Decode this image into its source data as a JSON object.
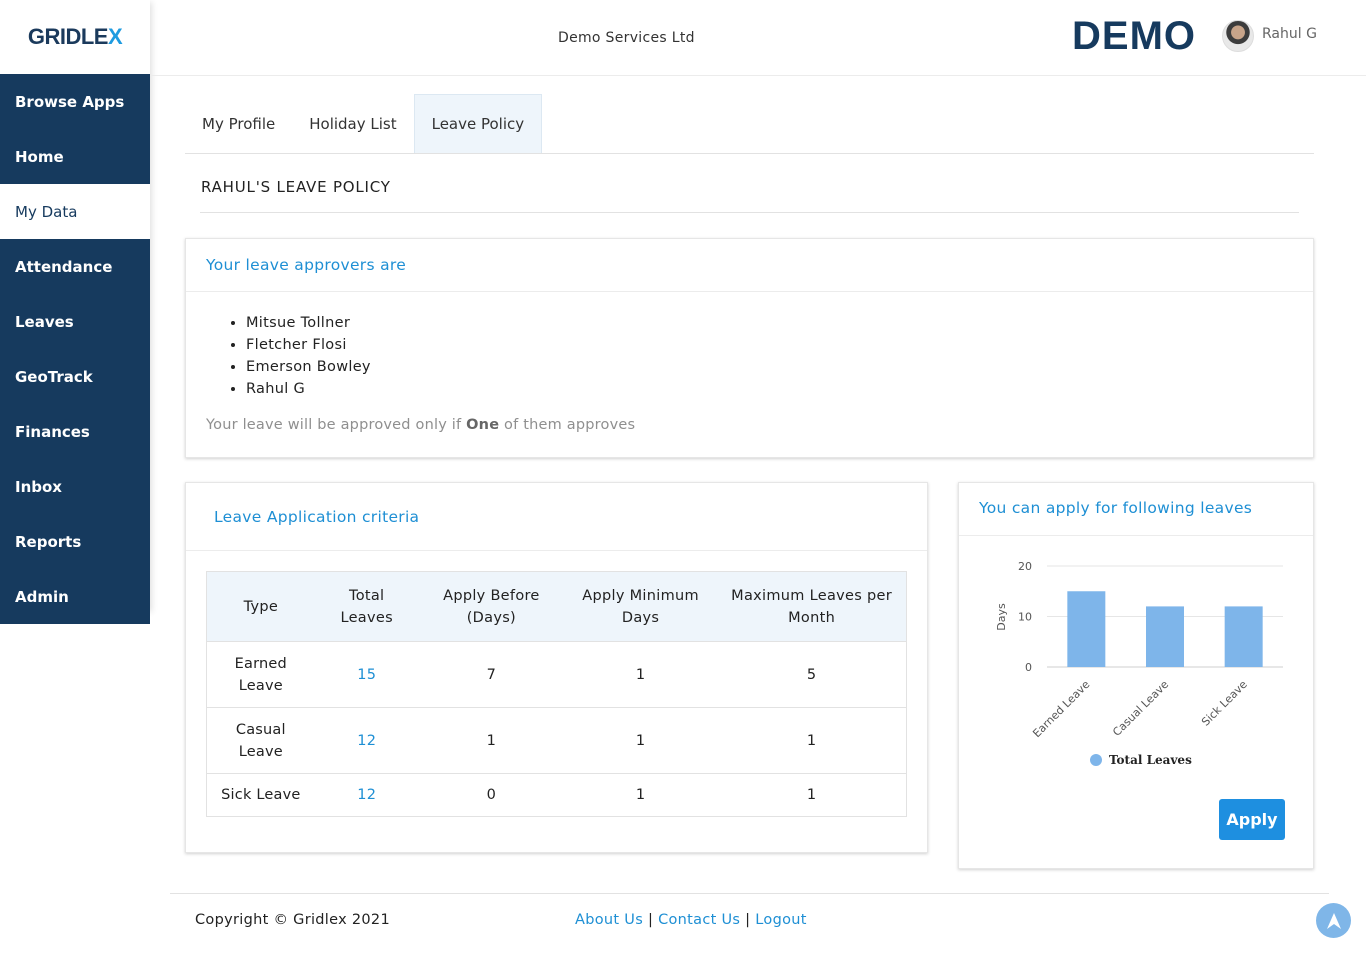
{
  "logo": {
    "text": "GRIDLE",
    "accent": "X"
  },
  "sidebar": {
    "items": [
      {
        "label": "Browse Apps"
      },
      {
        "label": "Home"
      },
      {
        "label": "My Data"
      },
      {
        "label": "Attendance"
      },
      {
        "label": "Leaves"
      },
      {
        "label": "GeoTrack"
      },
      {
        "label": "Finances"
      },
      {
        "label": "Inbox"
      },
      {
        "label": "Reports"
      },
      {
        "label": "Admin"
      }
    ],
    "active": "My Data"
  },
  "header": {
    "company": "Demo Services Ltd",
    "brand": "DEMO",
    "user_name": "Rahul G"
  },
  "tabs": [
    {
      "label": "My Profile"
    },
    {
      "label": "Holiday List"
    },
    {
      "label": "Leave Policy"
    }
  ],
  "active_tab": "Leave Policy",
  "page_title": "RAHUL'S LEAVE POLICY",
  "approvers": {
    "title": "Your leave approvers are",
    "names": [
      "Mitsue Tollner",
      "Fletcher Flosi",
      "Emerson Bowley",
      "Rahul G"
    ],
    "note_prefix": "Your leave will be approved only if ",
    "note_bold": "One",
    "note_suffix": " of them approves"
  },
  "criteria": {
    "title": "Leave Application criteria",
    "columns": [
      "Type",
      "Total Leaves",
      "Apply Before (Days)",
      "Apply Minimum Days",
      "Maximum Leaves per Month"
    ],
    "rows": [
      {
        "type": "Earned Leave",
        "total": "15",
        "before": "7",
        "min": "1",
        "max": "5"
      },
      {
        "type": "Casual Leave",
        "total": "12",
        "before": "1",
        "min": "1",
        "max": "1"
      },
      {
        "type": "Sick Leave",
        "total": "12",
        "before": "0",
        "min": "1",
        "max": "1"
      }
    ]
  },
  "leaves_card": {
    "title": "You can apply for following leaves",
    "apply_label": "Apply"
  },
  "chart_data": {
    "type": "bar",
    "categories": [
      "Earned Leave",
      "Casual Leave",
      "Sick Leave"
    ],
    "series": [
      {
        "name": "Total Leaves",
        "values": [
          15,
          12,
          12
        ]
      }
    ],
    "ylabel": "Days",
    "yticks": [
      0,
      10,
      20
    ],
    "ylim": [
      0,
      20
    ],
    "bar_color": "#7eb5ea",
    "legend_position": "bottom",
    "grid": true
  },
  "footer": {
    "copyright": "Copyright © Gridlex 2021",
    "links": [
      "About Us",
      "Contact Us",
      "Logout"
    ],
    "separator": " | "
  },
  "colors": {
    "sidebar": "#163a5e",
    "accent": "#1e8fd4",
    "table_header": "#eef5fb"
  }
}
